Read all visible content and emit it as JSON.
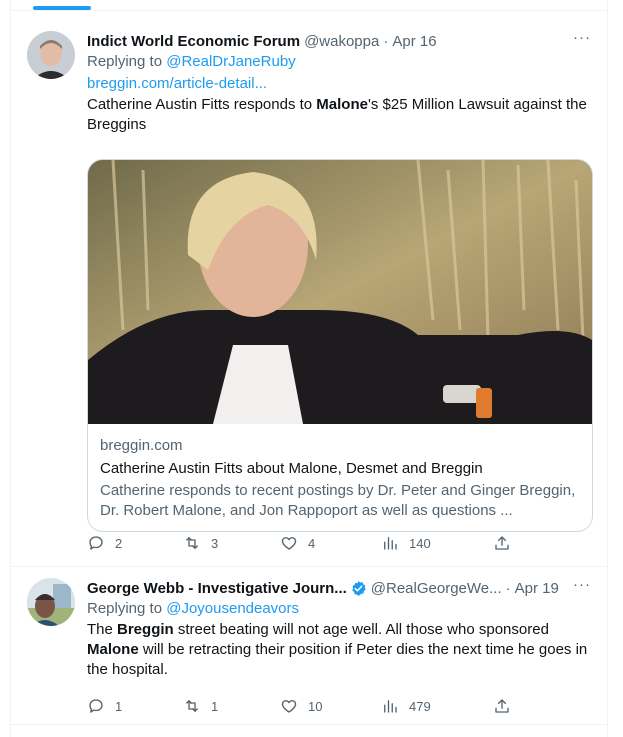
{
  "tweets": [
    {
      "display_name": "Indict World Economic Forum",
      "handle": "@wakoppa",
      "separator": "·",
      "time": "Apr 16",
      "more": "···",
      "replying_prefix": "Replying to",
      "replying_to": "@RealDrJaneRuby",
      "link": "breggin.com/article-detail...",
      "text": {
        "part1": "Catherine Austin Fitts responds to ",
        "bold1": "Malone",
        "part2": "'s $25 Million Lawsuit against the Breggins"
      },
      "card": {
        "domain": "breggin.com",
        "title": "Catherine Austin Fitts about Malone, Desmet and Breggin",
        "description": "Catherine responds to recent postings by Dr. Peter and Ginger Breggin, Dr. Robert Malone, and Jon Rappoport as well as questions ..."
      },
      "stats": {
        "replies": "2",
        "retweets": "3",
        "likes": "4",
        "views": "140"
      }
    },
    {
      "display_name": "George Webb - Investigative Journ...",
      "verified": true,
      "handle": "@RealGeorgeWe...",
      "separator": "·",
      "time": "Apr 19",
      "more": "···",
      "replying_prefix": "Replying to",
      "replying_to": "@Joyousendeavors",
      "text": {
        "part1": "The ",
        "bold1": "Breggin",
        "part2": " street beating will not age well. All those who sponsored ",
        "bold2": "Malone",
        "part3": " will be retracting their position if Peter dies the next time he goes in the hospital."
      },
      "stats": {
        "replies": "1",
        "retweets": "1",
        "likes": "10",
        "views": "479"
      }
    }
  ],
  "colors": {
    "accent": "#1d9bf0",
    "secondary_text": "#536471",
    "primary_text": "#0f1419",
    "border": "#eff3f4"
  },
  "icons": [
    "more-icon",
    "reply-icon",
    "retweet-icon",
    "like-icon",
    "views-icon",
    "share-icon",
    "verified-icon"
  ]
}
